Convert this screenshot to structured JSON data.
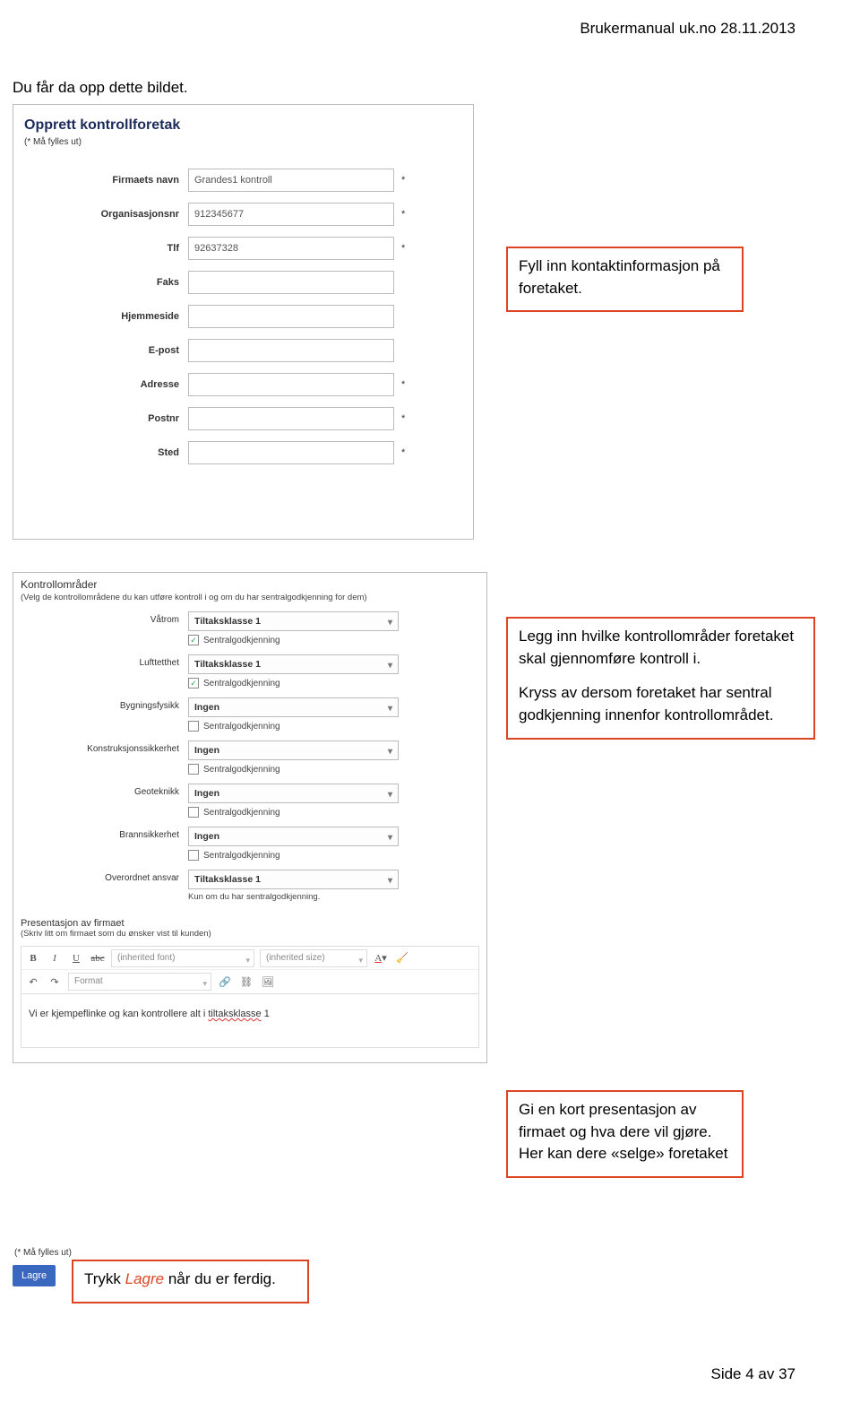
{
  "header": "Brukermanual uk.no 28.11.2013",
  "intro": "Du får da opp dette bildet.",
  "panel1": {
    "title": "Opprett kontrollforetak",
    "required_note": "(* Må fylles ut)",
    "fields": [
      {
        "label": "Firmaets navn",
        "value": "Grandes1 kontroll",
        "required": true
      },
      {
        "label": "Organisasjonsnr",
        "value": "912345677",
        "required": true
      },
      {
        "label": "Tlf",
        "value": "92637328",
        "required": true
      },
      {
        "label": "Faks",
        "value": "",
        "required": false
      },
      {
        "label": "Hjemmeside",
        "value": "",
        "required": false
      },
      {
        "label": "E-post",
        "value": "",
        "required": false
      },
      {
        "label": "Adresse",
        "value": "",
        "required": true
      },
      {
        "label": "Postnr",
        "value": "",
        "required": true
      },
      {
        "label": "Sted",
        "value": "",
        "required": true
      }
    ]
  },
  "callouts": {
    "c1": "Fyll inn kontaktinformasjon på foretaket.",
    "c2a": "Legg inn hvilke kontrollområder foretaket skal gjennomføre kontroll i.",
    "c2b": "Kryss av dersom foretaket har sentral godkjenning innenfor kontrollområdet.",
    "c3": "Gi en kort presentasjon av firmaet og hva dere vil gjøre. Her kan dere «selge» foretaket",
    "c4_pre": "Trykk ",
    "c4_em": "Lagre",
    "c4_post": " når du er ferdig."
  },
  "panel2": {
    "section1_title": "Kontrollområder",
    "section1_sub": "(Velg de kontrollområdene du kan utføre kontroll i og om du har sentralgodkjenning for dem)",
    "areas": [
      {
        "label": "Våtrom",
        "value": "Tiltaksklasse 1",
        "checked": true,
        "check_label": "Sentralgodkjenning"
      },
      {
        "label": "Lufttetthet",
        "value": "Tiltaksklasse 1",
        "checked": true,
        "check_label": "Sentralgodkjenning"
      },
      {
        "label": "Bygningsfysikk",
        "value": "Ingen",
        "checked": false,
        "check_label": "Sentralgodkjenning"
      },
      {
        "label": "Konstruksjonssikkerhet",
        "value": "Ingen",
        "checked": false,
        "check_label": "Sentralgodkjenning"
      },
      {
        "label": "Geoteknikk",
        "value": "Ingen",
        "checked": false,
        "check_label": "Sentralgodkjenning"
      },
      {
        "label": "Brannsikkerhet",
        "value": "Ingen",
        "checked": false,
        "check_label": "Sentralgodkjenning"
      },
      {
        "label": "Overordnet ansvar",
        "value": "Tiltaksklasse 1",
        "checked": null,
        "note": "Kun om du har sentralgodkjenning."
      }
    ],
    "section2_title": "Presentasjon av firmaet",
    "section2_sub": "(Skriv litt om firmaet som du ønsker vist til kunden)",
    "toolbar": {
      "font_sel": "(inherited font)",
      "size_sel": "(inherited size)",
      "format_sel": "Format"
    },
    "editor_pre": "Vi er kjempeflinke og kan kontrollere alt i ",
    "editor_typo": "tiltaksklasse",
    "editor_post": " 1"
  },
  "lagre": {
    "note": "(* Må fylles ut)",
    "label": "Lagre"
  },
  "footer": "Side 4 av 37"
}
